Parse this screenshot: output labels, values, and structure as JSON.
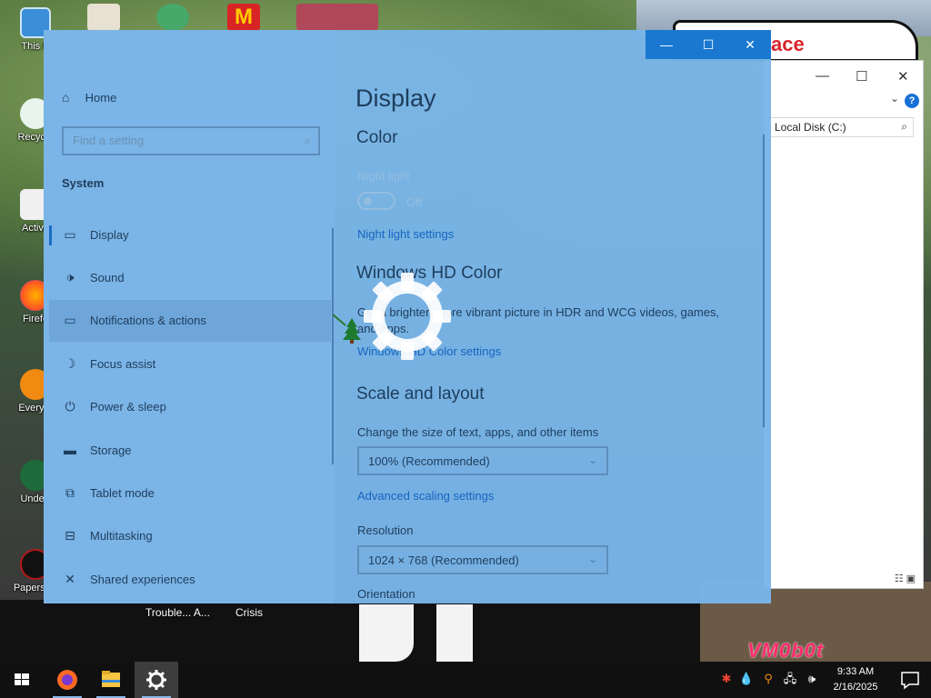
{
  "desktop": {
    "icons": [
      {
        "label": "This P"
      },
      {
        "label": "Recycle"
      },
      {
        "label": "Activa"
      },
      {
        "label": "Firefo"
      },
      {
        "label": "Everyth"
      },
      {
        "label": "Undert"
      },
      {
        "label": "Papers, P"
      }
    ],
    "bottom_labels": [
      "Trouble... A...",
      "Crisis"
    ],
    "watermark": "VM0b0t"
  },
  "explorer": {
    "banner_text": "ace",
    "address": "Local Disk (C:)",
    "help": "?"
  },
  "settings": {
    "window_controls": {
      "minimize": "—",
      "maximize": "☐",
      "close": "✕"
    },
    "sidebar": {
      "home": "Home",
      "search_placeholder": "Find a setting",
      "section": "System",
      "items": [
        {
          "label": "Display",
          "icon": "monitor-icon"
        },
        {
          "label": "Sound",
          "icon": "speaker-icon"
        },
        {
          "label": "Notifications & actions",
          "icon": "notification-icon"
        },
        {
          "label": "Focus assist",
          "icon": "moon-icon"
        },
        {
          "label": "Power & sleep",
          "icon": "power-icon"
        },
        {
          "label": "Storage",
          "icon": "storage-icon"
        },
        {
          "label": "Tablet mode",
          "icon": "tablet-icon"
        },
        {
          "label": "Multitasking",
          "icon": "multitasking-icon"
        },
        {
          "label": "Shared experiences",
          "icon": "shared-icon"
        }
      ]
    },
    "content": {
      "title": "Display",
      "color_heading": "Color",
      "night_light_label": "Night light",
      "night_light_state": "Off",
      "night_light_link": "Night light settings",
      "hd_heading": "Windows HD Color",
      "hd_desc_line1": "Get a brighter, more vibrant picture in HDR and WCG videos, games,",
      "hd_desc_line2": "and apps.",
      "hd_link": "Windows HD Color settings",
      "scale_heading": "Scale and layout",
      "scale_label": "Change the size of text, apps, and other items",
      "scale_value": "100% (Recommended)",
      "advanced_link": "Advanced scaling settings",
      "resolution_label": "Resolution",
      "resolution_value": "1024 × 768 (Recommended)",
      "orientation_label": "Orientation"
    }
  },
  "taskbar": {
    "apps": [
      "start-button",
      "firefox",
      "file-explorer",
      "settings"
    ],
    "clock_time": "9:33 AM",
    "clock_date": "2/16/2025"
  },
  "colors": {
    "settings_bg": "#79b5e9",
    "accent": "#1a78d0",
    "link": "#1565c0",
    "taskbar": "#101010"
  }
}
